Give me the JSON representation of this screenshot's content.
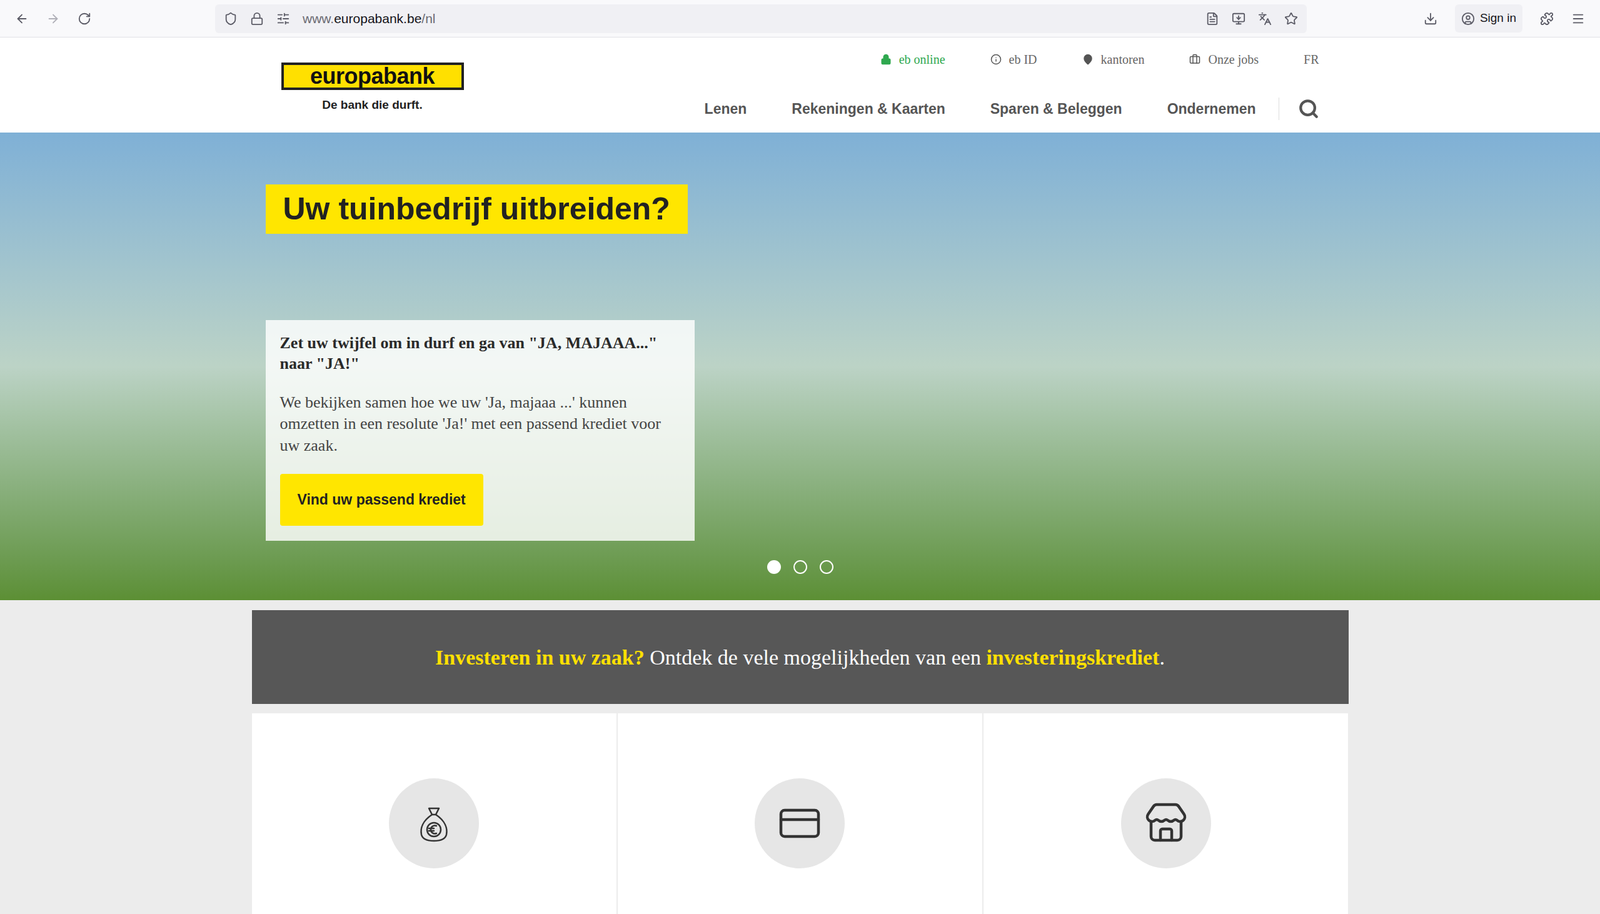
{
  "browser": {
    "url": {
      "prefix": "www.",
      "domain": "europabank.be",
      "path": "/nl"
    },
    "sign_in": "Sign in"
  },
  "site": {
    "logo": "europabank",
    "tagline": "De bank die durft.",
    "top_links": [
      {
        "label": "eb online",
        "kind": "lock",
        "color": "#2fa84f"
      },
      {
        "label": "eb ID",
        "kind": "info",
        "color": "#666666"
      },
      {
        "label": "kantoren",
        "kind": "pin",
        "color": "#666666"
      },
      {
        "label": "Onze jobs",
        "kind": "briefcase",
        "color": "#666666"
      },
      {
        "label": "FR",
        "kind": "none",
        "color": "#666666"
      }
    ],
    "nav": [
      "Lenen",
      "Rekeningen & Kaarten",
      "Sparen & Beleggen",
      "Ondernemen"
    ]
  },
  "hero": {
    "heading": "Uw tuinbedrijf uitbreiden?",
    "title": "Zet uw twijfel om in durf en ga van \"JA, MAJAAA...\" naar \"JA!\"",
    "body": "We bekijken samen hoe we uw 'Ja, majaaa ...' kunnen omzetten in een resolute 'Ja!' met een passend krediet voor uw zaak.",
    "button": "Vind uw passend krediet",
    "slides": [
      {
        "selected": true
      },
      {
        "selected": false
      },
      {
        "selected": false
      }
    ]
  },
  "banner": [
    {
      "text": "Investeren in uw zaak?",
      "highlight": true
    },
    {
      "text": " Ontdek de vele mogelijkheden van een ",
      "highlight": false
    },
    {
      "text": "investeringskrediet",
      "highlight": true
    },
    {
      "text": ".",
      "highlight": false
    }
  ],
  "cards": [
    {
      "kind": "money"
    },
    {
      "kind": "card"
    },
    {
      "kind": "shop"
    }
  ]
}
